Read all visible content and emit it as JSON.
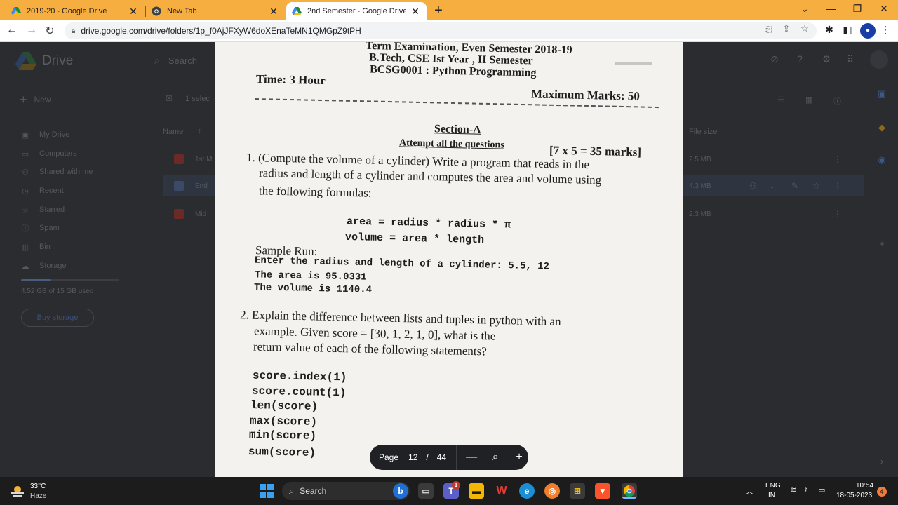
{
  "browser": {
    "tabs": [
      {
        "title": "2019-20 - Google Drive",
        "icon": "google-drive-icon",
        "active": false
      },
      {
        "title": "New Tab",
        "icon": "chrome-icon",
        "active": false
      },
      {
        "title": "2nd Semester - Google Drive",
        "icon": "google-drive-icon",
        "active": true
      }
    ],
    "close_glyph": "✕",
    "new_tab_glyph": "+",
    "url": "drive.google.com/drive/folders/1p_f0AjJFXyW6doXEnaTeMN1QMGpZ9tPH"
  },
  "drive": {
    "logo_text": "Drive",
    "search_placeholder": "Search",
    "new_label": "New",
    "selected_text": "1 selec",
    "nav": [
      {
        "label": "My Drive",
        "icon": "my-drive-icon"
      },
      {
        "label": "Computers",
        "icon": "computers-icon"
      },
      {
        "label": "Shared with me",
        "icon": "shared-icon"
      },
      {
        "label": "Recent",
        "icon": "clock-icon"
      },
      {
        "label": "Starred",
        "icon": "star-icon"
      },
      {
        "label": "Spam",
        "icon": "spam-icon"
      },
      {
        "label": "Bin",
        "icon": "bin-icon"
      },
      {
        "label": "Storage",
        "icon": "cloud-icon"
      }
    ],
    "storage_used_text": "4.52 GB of 15 GB used",
    "storage_fraction": 0.3,
    "buy_storage_label": "Buy storage",
    "col_name": "Name",
    "col_size": "File size",
    "rows": [
      {
        "name": "1st M",
        "size": "2.5 MB",
        "selected": false
      },
      {
        "name": "End",
        "size": "4.3 MB",
        "selected": true
      },
      {
        "name": "Mid",
        "size": "2.3 MB",
        "selected": false
      }
    ]
  },
  "pdf": {
    "header_line1": "Term Examination, Even Semester 2018-19",
    "header_line2": "B.Tech, CSE  Ist Year , II Semester",
    "header_line3": "BCSG0001 : Python Programming",
    "time": "Time: 3 Hour",
    "max_marks": "Maximum Marks: 50",
    "section": "Section-A",
    "attempt": "Attempt all the questions",
    "marks": "[7 x 5 = 35 marks]",
    "q1_line1": "1. (Compute the volume of a cylinder) Write a program that reads in the",
    "q1_line2": "radius and length of a cylinder and computes the area and volume using",
    "q1_line3": "the following formulas:",
    "formula1": "area = radius * radius * π",
    "formula2": "volume = area * length",
    "sample_run": "Sample Run:",
    "sample1": "Enter the radius and length of a cylinder: 5.5, 12",
    "sample2": "The area is 95.0331",
    "sample3": "The volume is 1140.4",
    "q2_line1": "2. Explain the difference between lists and tuples in python with an",
    "q2_line2": "example. Given   score = [30, 1, 2, 1, 0], what is the",
    "q2_line3": "return value of each of the following statements?",
    "code": [
      "score.index(1)",
      "score.count(1)",
      "len(score)",
      "max(score)",
      "min(score)",
      "sum(score)"
    ]
  },
  "pager": {
    "label": "Page",
    "current": "12",
    "separator": "/",
    "total": "44",
    "zoom_out": "—",
    "zoom_in": "+"
  },
  "taskbar": {
    "temperature": "33°C",
    "condition": "Haze",
    "search_label": "Search",
    "language_line1": "ENG",
    "language_line2": "IN",
    "time": "10:54",
    "date": "18-05-2023",
    "notification_count": "4",
    "teams_badge": "1"
  },
  "colors": {
    "tab_strip": "#f5ae3f",
    "taskbar": "#1c1c1c",
    "pager_bg": "#202124",
    "paper": "#f4f2ee"
  }
}
